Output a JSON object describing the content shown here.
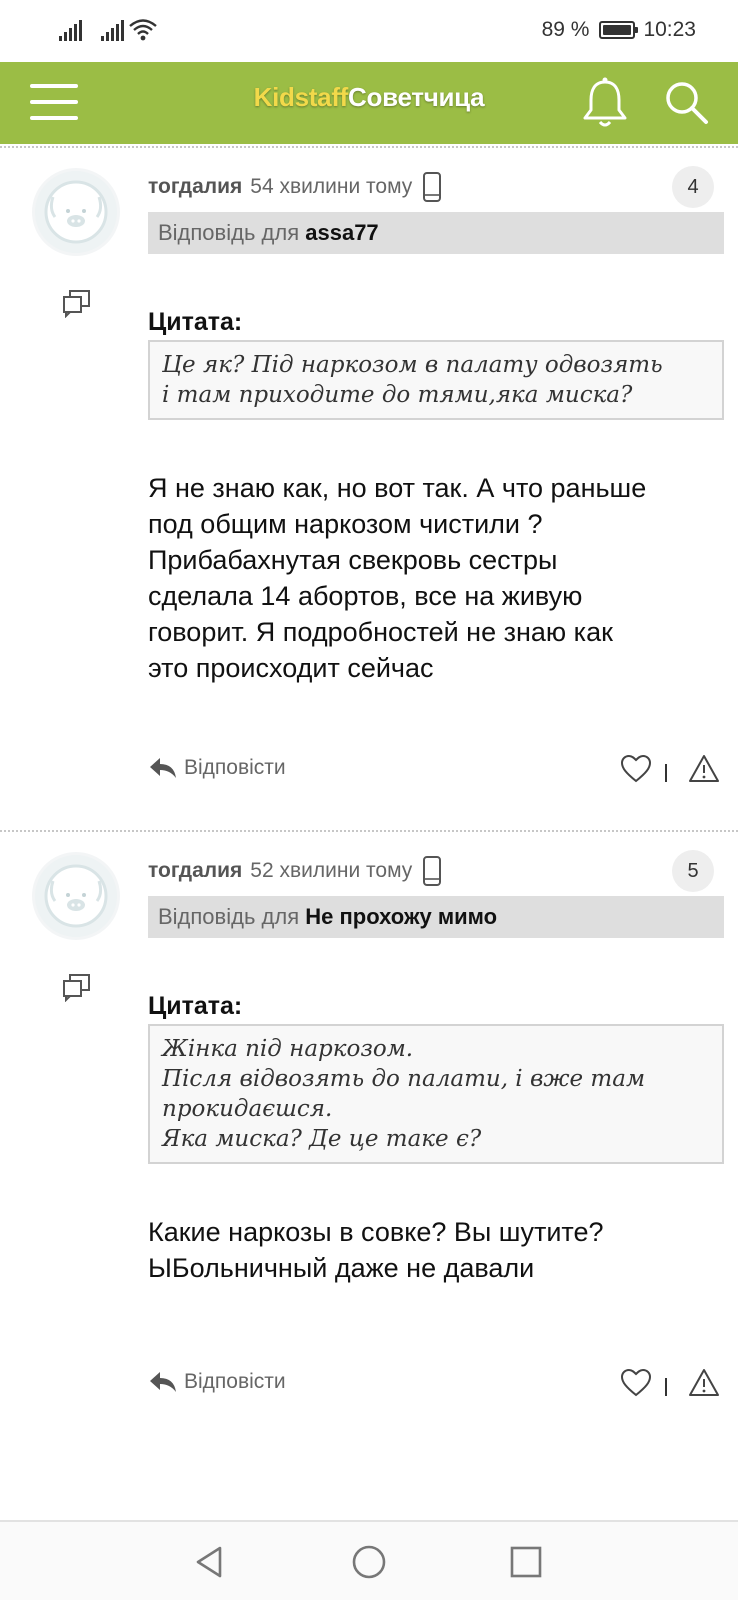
{
  "status_bar": {
    "battery": "89 %",
    "time": "10:23"
  },
  "header": {
    "logo_part1": "Kidstaff",
    "logo_part2": "Советчица"
  },
  "posts": [
    {
      "author": "тогдалия",
      "time": "54 хвилини тому",
      "number": "4",
      "reply_prefix": "Відповідь для",
      "reply_to": "assa77",
      "quote_label": "Цитата:",
      "quote_lines": [
        "Це як? Під наркозом в палату одвозять",
        "і там приходите до тями,яка миска?"
      ],
      "body_lines": [
        "Я не знаю как, но вот так. А что раньше",
        "под общим наркозом чистили ?",
        "Прибабахнутая свекровь сестры",
        "сделала 14 абортов, все на живую",
        "говорит. Я подробностей не знаю как",
        "это происходит сейчас"
      ],
      "reply_label": "Відповісти"
    },
    {
      "author": "тогдалия",
      "time": "52 хвилини тому",
      "number": "5",
      "reply_prefix": "Відповідь для",
      "reply_to": "Не прохожу мимо",
      "quote_label": "Цитата:",
      "quote_lines": [
        "Жінка під наркозом.",
        "Після відвозять до палати, і вже там",
        "прокидаєшся.",
        "Яка миска? Де це таке є?"
      ],
      "body_lines": [
        "Какие наркозы в совке? Вы шутите?",
        "ЫБольничный даже не давали"
      ],
      "reply_label": "Відповісти"
    }
  ],
  "colors": {
    "header_bg": "#9bbd45",
    "logo_accent": "#f2d94a"
  },
  "icons": [
    "signal-icon",
    "wifi-icon",
    "battery-icon",
    "menu-icon",
    "bell-icon",
    "search-icon",
    "avatar-icon",
    "copy-icon",
    "phone-icon",
    "reply-arrow-icon",
    "heart-icon",
    "warning-icon",
    "back-icon",
    "home-icon",
    "recents-icon"
  ]
}
